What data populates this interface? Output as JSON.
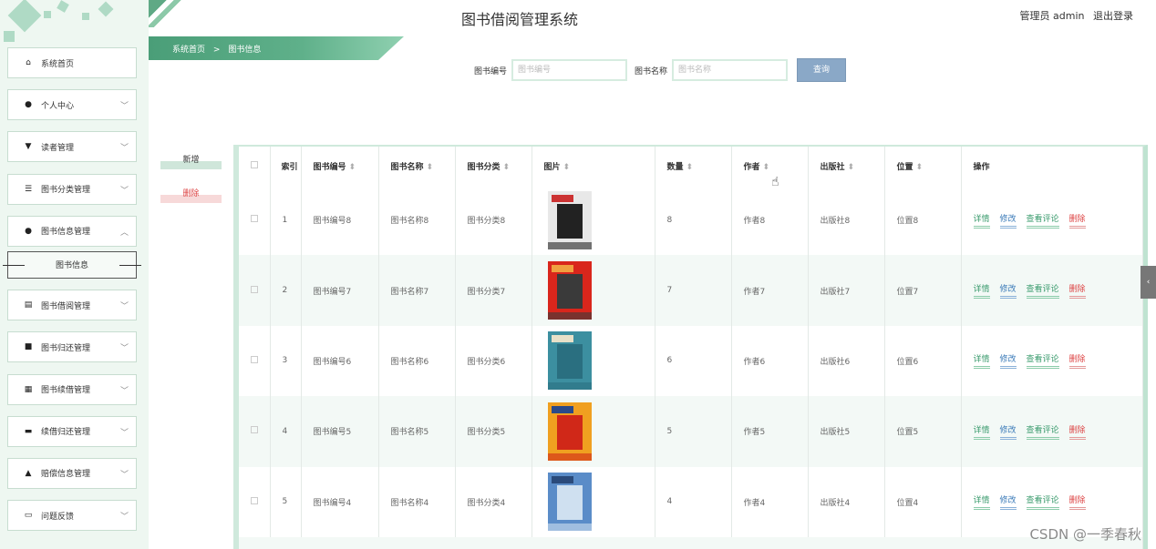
{
  "header": {
    "title": "图书借阅管理系统",
    "user_text": "管理员 admin",
    "logout": "退出登录"
  },
  "breadcrumb": {
    "home": "系统首页",
    "separator": ">",
    "current": "图书信息"
  },
  "search": {
    "code_label": "图书编号",
    "code_placeholder": "图书编号",
    "name_label": "图书名称",
    "name_placeholder": "图书名称",
    "button": "查询"
  },
  "actions": {
    "add": "新增",
    "delete": "删除"
  },
  "sidebar": {
    "items": [
      {
        "label": "系统首页",
        "icon": "home-icon",
        "glyph": "⌂",
        "expandable": false
      },
      {
        "label": "个人中心",
        "icon": "user-icon",
        "glyph": "👤",
        "expandable": true
      },
      {
        "label": "读者管理",
        "icon": "reader-icon",
        "glyph": "▼",
        "expandable": true
      },
      {
        "label": "图书分类管理",
        "icon": "sliders-icon",
        "glyph": "☰",
        "expandable": true
      },
      {
        "label": "图书信息管理",
        "icon": "bulb-icon",
        "glyph": "●",
        "expandable": true,
        "open": true
      },
      {
        "label": "图书借阅管理",
        "icon": "clipboard-icon",
        "glyph": "▤",
        "expandable": true
      },
      {
        "label": "图书归还管理",
        "icon": "video-icon",
        "glyph": "■",
        "expandable": true
      },
      {
        "label": "图书续借管理",
        "icon": "grid-icon",
        "glyph": "▦",
        "expandable": true
      },
      {
        "label": "续借归还管理",
        "icon": "monitor-icon",
        "glyph": "▬",
        "expandable": true
      },
      {
        "label": "赔偿信息管理",
        "icon": "thumb-icon",
        "glyph": "▲",
        "expandable": true
      },
      {
        "label": "问题反馈",
        "icon": "printer-icon",
        "glyph": "▭",
        "expandable": true
      }
    ],
    "submenu": "图书信息"
  },
  "table": {
    "headers": [
      "索引",
      "图书编号",
      "图书名称",
      "图书分类",
      "图片",
      "数量",
      "作者",
      "出版社",
      "位置",
      "操作"
    ],
    "rows": [
      {
        "idx": "1",
        "code": "图书编号8",
        "name": "图书名称8",
        "cat": "图书分类8",
        "qty": "8",
        "author": "作者8",
        "pub": "出版社8",
        "pos": "位置8",
        "cover_colors": [
          "#e8e8e8",
          "#222",
          "#c33"
        ]
      },
      {
        "idx": "2",
        "code": "图书编号7",
        "name": "图书名称7",
        "cat": "图书分类7",
        "qty": "7",
        "author": "作者7",
        "pub": "出版社7",
        "pos": "位置7",
        "cover_colors": [
          "#d9261c",
          "#3a3a3a",
          "#f0a040"
        ]
      },
      {
        "idx": "3",
        "code": "图书编号6",
        "name": "图书名称6",
        "cat": "图书分类6",
        "qty": "6",
        "author": "作者6",
        "pub": "出版社6",
        "pos": "位置6",
        "cover_colors": [
          "#3c8fa0",
          "#2a6f80",
          "#e8e0c8"
        ]
      },
      {
        "idx": "4",
        "code": "图书编号5",
        "name": "图书名称5",
        "cat": "图书分类5",
        "qty": "5",
        "author": "作者5",
        "pub": "出版社5",
        "pos": "位置5",
        "cover_colors": [
          "#f0a020",
          "#d02818",
          "#2a4a8a"
        ]
      },
      {
        "idx": "5",
        "code": "图书编号4",
        "name": "图书名称4",
        "cat": "图书分类4",
        "qty": "4",
        "author": "作者4",
        "pub": "出版社4",
        "pos": "位置4",
        "cover_colors": [
          "#5a8cc8",
          "#cfe0f0",
          "#2a4a7a"
        ]
      }
    ],
    "ops": {
      "detail": "详情",
      "edit": "修改",
      "comment": "查看评论",
      "delete": "删除"
    }
  },
  "watermark": "CSDN @一季春秋",
  "colors": {
    "accent": "#5fb08a",
    "sidebar_bg": "#eef7f1",
    "danger": "#dd4444",
    "link_blue": "#3a7ab8"
  }
}
